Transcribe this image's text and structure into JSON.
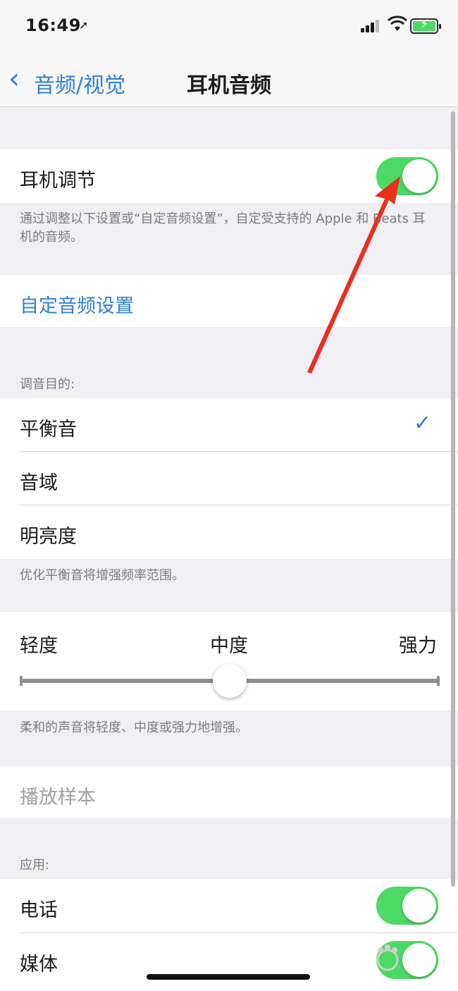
{
  "status": {
    "time": "16:49"
  },
  "nav": {
    "back_label": "音频/视觉",
    "title": "耳机音频"
  },
  "headphone_adjust": {
    "label": "耳机调节",
    "on": true,
    "footer": "通过调整以下设置或“自定音频设置”，自定受支持的 Apple 和 Beats 耳机的音频。"
  },
  "custom_audio": {
    "label": "自定音频设置"
  },
  "tune_for": {
    "header": "调音目的:",
    "options": [
      {
        "label": "平衡音",
        "selected": true
      },
      {
        "label": "音域",
        "selected": false
      },
      {
        "label": "明亮度",
        "selected": false
      }
    ],
    "footer": "优化平衡音将增强频率范围。"
  },
  "strength": {
    "labels": [
      "轻度",
      "中度",
      "强力"
    ],
    "value": 0.5,
    "footer": "柔和的声音将轻度、中度或强力地增强。"
  },
  "play_sample": {
    "label": "播放样本"
  },
  "apply": {
    "header": "应用:",
    "items": [
      {
        "label": "电话",
        "on": true
      },
      {
        "label": "媒体",
        "on": true
      }
    ]
  },
  "colors": {
    "accent": "#2f7ed8",
    "toggle_on": "#4cd964",
    "arrow": "#e8301c"
  }
}
